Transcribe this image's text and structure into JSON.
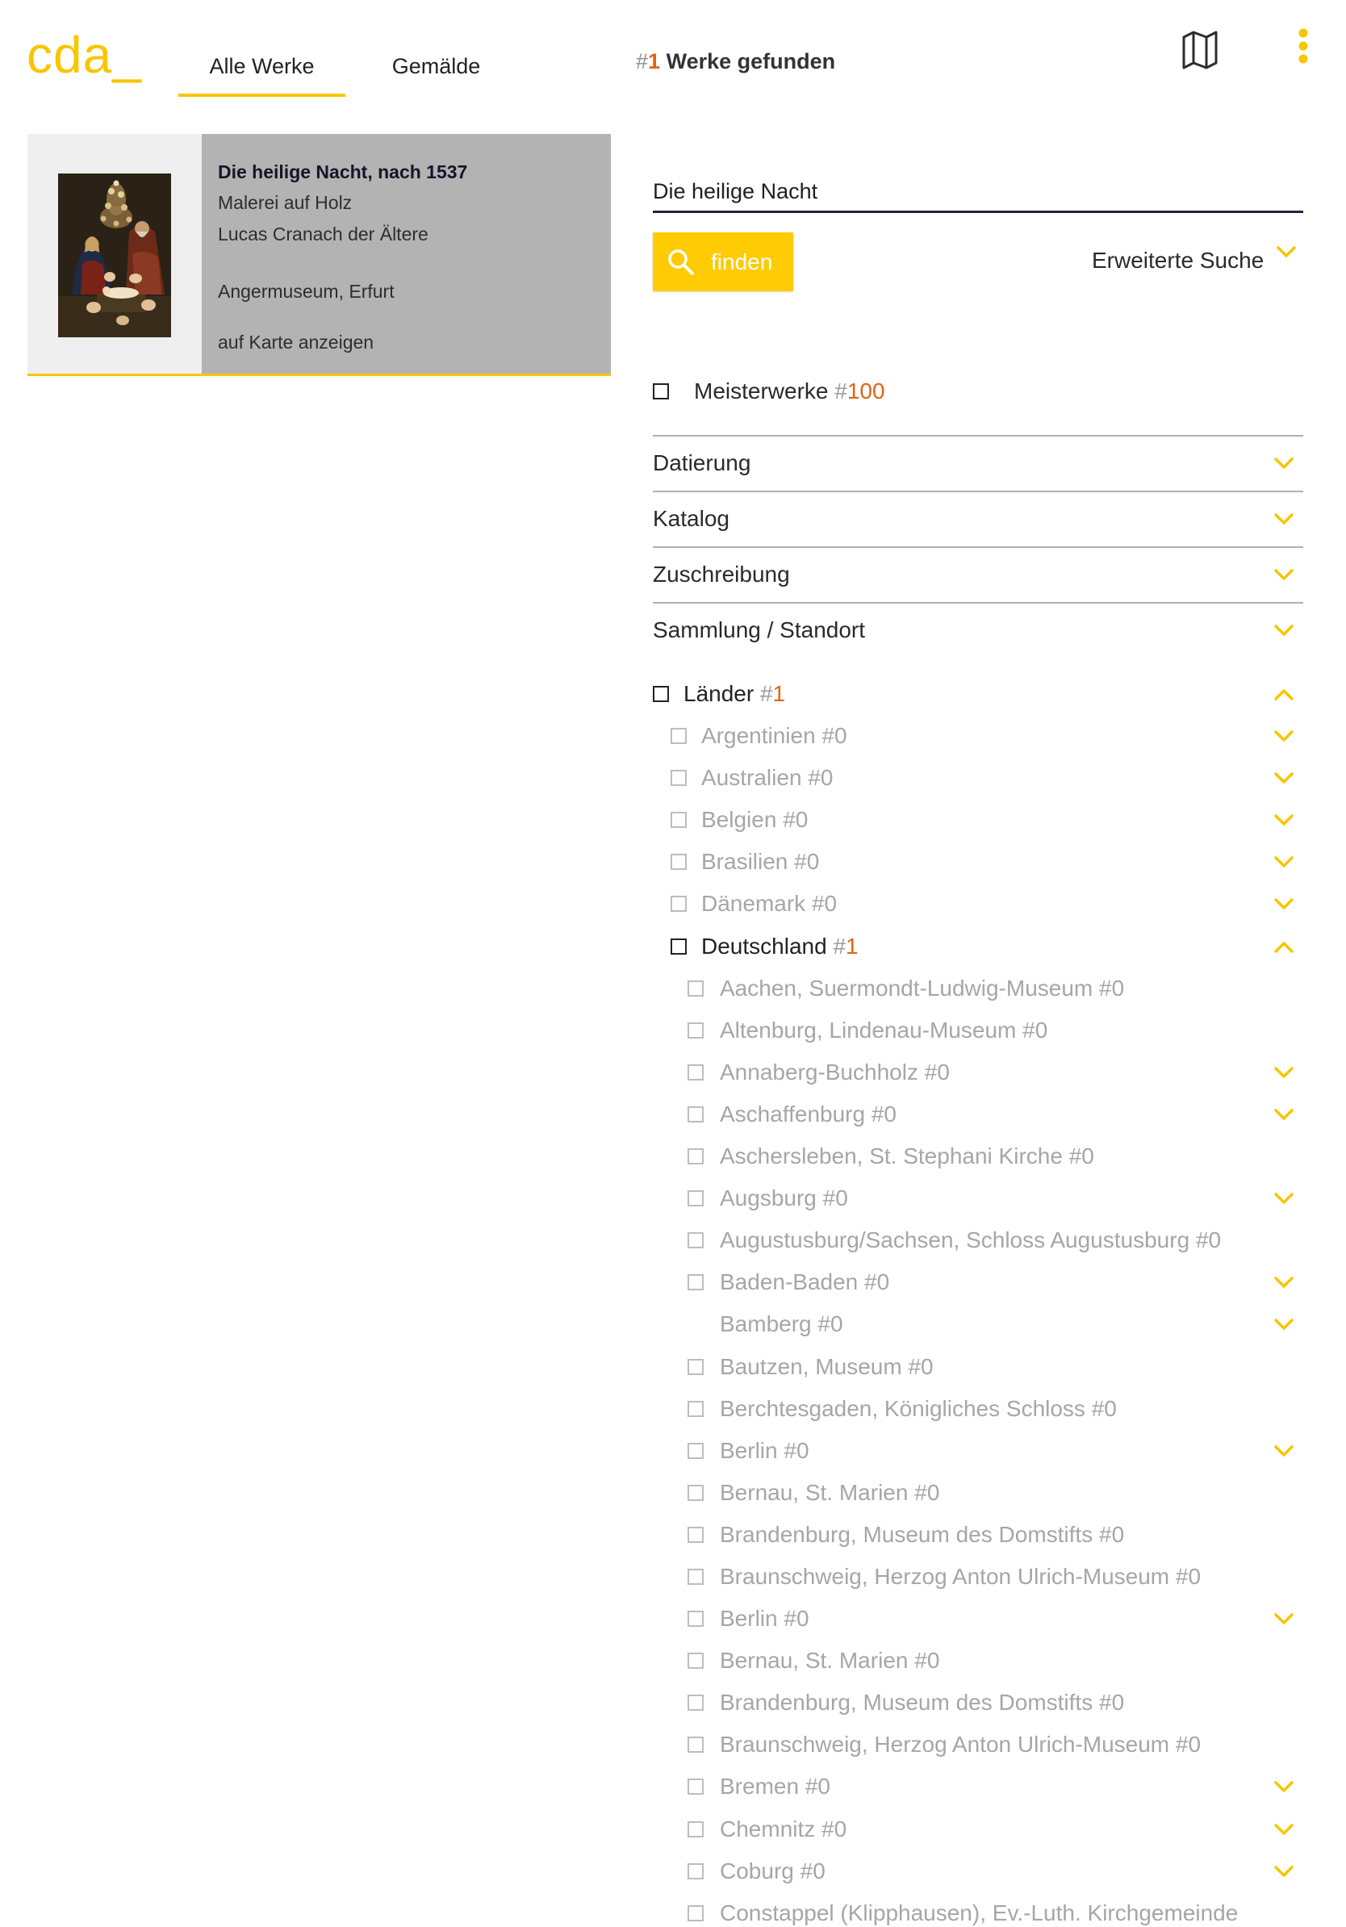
{
  "app": {
    "logo": "cda_"
  },
  "symbols": {
    "count_prefix": "#"
  },
  "colors": {
    "accent": "#f7c600",
    "count_highlight": "#e2650f",
    "text": "#242424",
    "text_muted": "#a6a6a6",
    "card_thumb_bg": "#efefef",
    "card_info_bg": "#b3b3b3",
    "search_underline": "#23233f"
  },
  "icons": {
    "map": "map-icon",
    "menu": "more-vertical-icon",
    "search": "search-icon",
    "expand": "chevron-down-icon",
    "collapse": "chevron-up-icon"
  },
  "header": {
    "tabs": [
      {
        "label": "Alle Werke",
        "active": true
      },
      {
        "label": "Gemälde",
        "active": false
      }
    ],
    "result_summary": {
      "count": "1",
      "label": "Werke gefunden"
    }
  },
  "results": [
    {
      "title": "Die heilige Nacht, nach 1537",
      "technique": "Malerei auf Holz",
      "artist": "Lucas Cranach der Ältere",
      "location": "Angermuseum, Erfurt",
      "map_link": "auf Karte anzeigen"
    }
  ],
  "search": {
    "query": "Die heilige Nacht",
    "submit_label": "finden",
    "advanced_label": "Erweiterte Suche",
    "advanced_expanded": false
  },
  "filters": {
    "masterpieces": {
      "label": "Meisterwerke",
      "count": "100",
      "checked": false
    },
    "sections": [
      {
        "label": "Datierung",
        "expanded": false
      },
      {
        "label": "Katalog",
        "expanded": false
      },
      {
        "label": "Zuschreibung",
        "expanded": false
      },
      {
        "label": "Sammlung / Standort",
        "expanded": false
      }
    ]
  },
  "tree": {
    "root": {
      "label": "Länder",
      "count": "1",
      "enabled": true,
      "checkbox": true,
      "expandable": true,
      "expanded": true
    },
    "countries": [
      {
        "label": "Argentinien",
        "count": "0",
        "enabled": false,
        "checkbox": true,
        "expandable": true,
        "expanded": false
      },
      {
        "label": "Australien",
        "count": "0",
        "enabled": false,
        "checkbox": true,
        "expandable": true,
        "expanded": false
      },
      {
        "label": "Belgien",
        "count": "0",
        "enabled": false,
        "checkbox": true,
        "expandable": true,
        "expanded": false
      },
      {
        "label": "Brasilien",
        "count": "0",
        "enabled": false,
        "checkbox": true,
        "expandable": true,
        "expanded": false
      },
      {
        "label": "Dänemark",
        "count": "0",
        "enabled": false,
        "checkbox": true,
        "expandable": true,
        "expanded": false
      },
      {
        "label": "Deutschland",
        "count": "1",
        "enabled": true,
        "checkbox": true,
        "expandable": true,
        "expanded": true
      }
    ],
    "cities": [
      {
        "label": "Aachen, Suermondt-Ludwig-Museum",
        "count": "0",
        "enabled": false,
        "checkbox": true,
        "expandable": false
      },
      {
        "label": "Altenburg, Lindenau-Museum",
        "count": "0",
        "enabled": false,
        "checkbox": true,
        "expandable": false
      },
      {
        "label": "Annaberg-Buchholz",
        "count": "0",
        "enabled": false,
        "checkbox": true,
        "expandable": true,
        "expanded": false
      },
      {
        "label": "Aschaffenburg",
        "count": "0",
        "enabled": false,
        "checkbox": true,
        "expandable": true,
        "expanded": false
      },
      {
        "label": "Aschersleben, St. Stephani Kirche",
        "count": "0",
        "enabled": false,
        "checkbox": true,
        "expandable": false
      },
      {
        "label": "Augsburg",
        "count": "0",
        "enabled": false,
        "checkbox": true,
        "expandable": true,
        "expanded": false
      },
      {
        "label": "Augustusburg/Sachsen, Schloss Augustusburg",
        "count": "0",
        "enabled": false,
        "checkbox": true,
        "expandable": false
      },
      {
        "label": "Baden-Baden",
        "count": "0",
        "enabled": false,
        "checkbox": true,
        "expandable": true,
        "expanded": false
      },
      {
        "label": "Bamberg",
        "count": "0",
        "enabled": false,
        "checkbox": false,
        "expandable": true,
        "expanded": false
      },
      {
        "label": "Bautzen, Museum",
        "count": "0",
        "enabled": false,
        "checkbox": true,
        "expandable": false
      },
      {
        "label": "Berchtesgaden, Königliches Schloss",
        "count": "0",
        "enabled": false,
        "checkbox": true,
        "expandable": false
      },
      {
        "label": "Berlin",
        "count": "0",
        "enabled": false,
        "checkbox": true,
        "expandable": true,
        "expanded": false
      },
      {
        "label": "Bernau, St. Marien",
        "count": "0",
        "enabled": false,
        "checkbox": true,
        "expandable": false
      },
      {
        "label": "Brandenburg, Museum des Domstifts",
        "count": "0",
        "enabled": false,
        "checkbox": true,
        "expandable": false
      },
      {
        "label": "Braunschweig, Herzog Anton Ulrich-Museum",
        "count": "0",
        "enabled": false,
        "checkbox": true,
        "expandable": false
      },
      {
        "label": "Berlin",
        "count": "0",
        "enabled": false,
        "checkbox": true,
        "expandable": true,
        "expanded": false
      },
      {
        "label": "Bernau, St. Marien",
        "count": "0",
        "enabled": false,
        "checkbox": true,
        "expandable": false
      },
      {
        "label": "Brandenburg, Museum des Domstifts",
        "count": "0",
        "enabled": false,
        "checkbox": true,
        "expandable": false
      },
      {
        "label": "Braunschweig, Herzog Anton Ulrich-Museum",
        "count": "0",
        "enabled": false,
        "checkbox": true,
        "expandable": false
      },
      {
        "label": "Bremen",
        "count": "0",
        "enabled": false,
        "checkbox": true,
        "expandable": true,
        "expanded": false
      },
      {
        "label": "Chemnitz",
        "count": "0",
        "enabled": false,
        "checkbox": true,
        "expandable": true,
        "expanded": false
      },
      {
        "label": "Coburg",
        "count": "0",
        "enabled": false,
        "checkbox": true,
        "expandable": true,
        "expanded": false
      },
      {
        "label": "Constappel (Klipphausen), Ev.-Luth. Kirchgemeinde",
        "enabled": false,
        "checkbox": true,
        "expandable": false
      }
    ]
  }
}
